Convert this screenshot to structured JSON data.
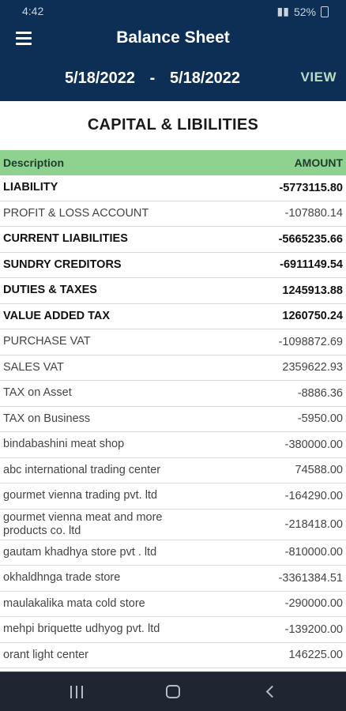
{
  "status_bar": {
    "time": "4:42",
    "battery": "52%"
  },
  "app_bar": {
    "title": "Balance Sheet",
    "from_date": "5/18/2022",
    "separator": "-",
    "to_date": "5/18/2022",
    "view_label": "VIEW"
  },
  "section_title": "CAPITAL & LIBILITIES",
  "table": {
    "headers": {
      "description": "Description",
      "amount": "AMOUNT"
    },
    "rows": [
      {
        "description": "LIABILITY",
        "amount": "-5773115.80",
        "bold": true
      },
      {
        "description": "PROFIT & LOSS ACCOUNT",
        "amount": "-107880.14",
        "bold": false
      },
      {
        "description": "CURRENT LIABILITIES",
        "amount": "-5665235.66",
        "bold": true
      },
      {
        "description": "SUNDRY CREDITORS",
        "amount": "-6911149.54",
        "bold": true
      },
      {
        "description": "DUTIES & TAXES",
        "amount": "1245913.88",
        "bold": true
      },
      {
        "description": "VALUE ADDED TAX",
        "amount": "1260750.24",
        "bold": true
      },
      {
        "description": "PURCHASE VAT",
        "amount": "-1098872.69",
        "bold": false
      },
      {
        "description": "SALES VAT",
        "amount": "2359622.93",
        "bold": false
      },
      {
        "description": "TAX on Asset",
        "amount": "-8886.36",
        "bold": false
      },
      {
        "description": "TAX on Business",
        "amount": "-5950.00",
        "bold": false
      },
      {
        "description": "bindabashini meat shop",
        "amount": "-380000.00",
        "bold": false
      },
      {
        "description": "abc international trading center",
        "amount": "74588.00",
        "bold": false
      },
      {
        "description": "gourmet vienna trading pvt. ltd",
        "amount": "-164290.00",
        "bold": false
      },
      {
        "description": "gourmet vienna meat and more products co. ltd",
        "amount": "-218418.00",
        "bold": false
      },
      {
        "description": "gautam khadhya store pvt . ltd",
        "amount": "-810000.00",
        "bold": false
      },
      {
        "description": "okhaldhnga trade store",
        "amount": "-3361384.51",
        "bold": false
      },
      {
        "description": "maulakalika mata cold store",
        "amount": "-290000.00",
        "bold": false
      },
      {
        "description": "mehpi briquette udhyog pvt. ltd",
        "amount": "-139200.00",
        "bold": false
      },
      {
        "description": "orant light center",
        "amount": "146225.00",
        "bold": false
      }
    ]
  }
}
